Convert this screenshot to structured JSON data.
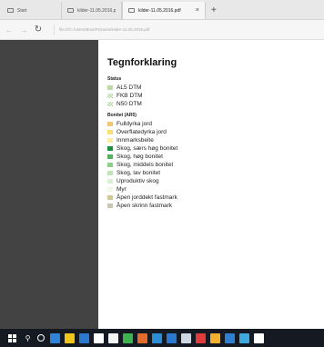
{
  "browser": {
    "tabs": [
      {
        "label": "Start"
      },
      {
        "label": "kilder-11.05.2016.pdf"
      },
      {
        "label": "kilder-11.05.2016.pdf",
        "active": true
      }
    ],
    "close_glyph": "×",
    "new_tab_glyph": "+",
    "back_glyph": "←",
    "forward_glyph": "→",
    "refresh_glyph": "↻",
    "url": "file:///C:/Users/Bruk/Pictures/kilder-11.05.2016.pdf"
  },
  "legend": {
    "title": "Tegnforklaring",
    "sections": [
      {
        "title": "Status",
        "items": [
          {
            "label": "AL5 DTM",
            "color": "#bcd9a8",
            "hatched": false
          },
          {
            "label": "FKB DTM",
            "color": "#9fd08f",
            "hatched": true
          },
          {
            "label": "N50 DTM",
            "color": "#9fd08f",
            "hatched": true
          }
        ]
      },
      {
        "title": "Bonitet (AR5)",
        "items": [
          {
            "label": "Fulldyrka jord",
            "color": "#f2c773"
          },
          {
            "label": "Overflatedyrka jord",
            "color": "#f7df7a"
          },
          {
            "label": "Innmarksbeite",
            "color": "#fbeea0"
          },
          {
            "label": "Skog, særs høg bonitet",
            "color": "#1e8f3c"
          },
          {
            "label": "Skog, høg bonitet",
            "color": "#55b15e"
          },
          {
            "label": "Skog, middels bonitet",
            "color": "#8ccf86"
          },
          {
            "label": "Skog, lav bonitet",
            "color": "#bfe2b6"
          },
          {
            "label": "Uproduktiv skog",
            "color": "#dcefd5"
          },
          {
            "label": "Myr",
            "color": "#f3f7ea"
          },
          {
            "label": "Åpen jorddekt fastmark",
            "color": "#cfc895"
          },
          {
            "label": "Åpen skrinn fastmark",
            "color": "#c9c7b2"
          }
        ]
      }
    ]
  },
  "taskbar": {
    "icons": [
      {
        "name": "start-icon",
        "color": "#ffffff"
      },
      {
        "name": "search-icon",
        "color": "#ffffff"
      },
      {
        "name": "task-view-icon",
        "color": "#ffffff"
      },
      {
        "name": "edge-icon",
        "color": "#2f83d8"
      },
      {
        "name": "file-explorer-icon",
        "color": "#f0c419"
      },
      {
        "name": "store-icon",
        "color": "#2b78d0"
      },
      {
        "name": "app-icon-1",
        "color": "#ffffff"
      },
      {
        "name": "app-icon-2",
        "color": "#f4f4f4"
      },
      {
        "name": "app-icon-3",
        "color": "#3fb34f"
      },
      {
        "name": "app-icon-4",
        "color": "#e36b2c"
      },
      {
        "name": "app-icon-5",
        "color": "#2b8dd6"
      },
      {
        "name": "app-icon-6",
        "color": "#2b78d0"
      },
      {
        "name": "app-icon-7",
        "color": "#cfd8e0"
      },
      {
        "name": "app-icon-8",
        "color": "#e23b3b"
      },
      {
        "name": "app-icon-9",
        "color": "#f1b12e"
      },
      {
        "name": "app-icon-10",
        "color": "#2e7fd1"
      },
      {
        "name": "app-icon-11",
        "color": "#3da9e0"
      },
      {
        "name": "app-icon-12",
        "color": "#ffffff"
      }
    ]
  }
}
